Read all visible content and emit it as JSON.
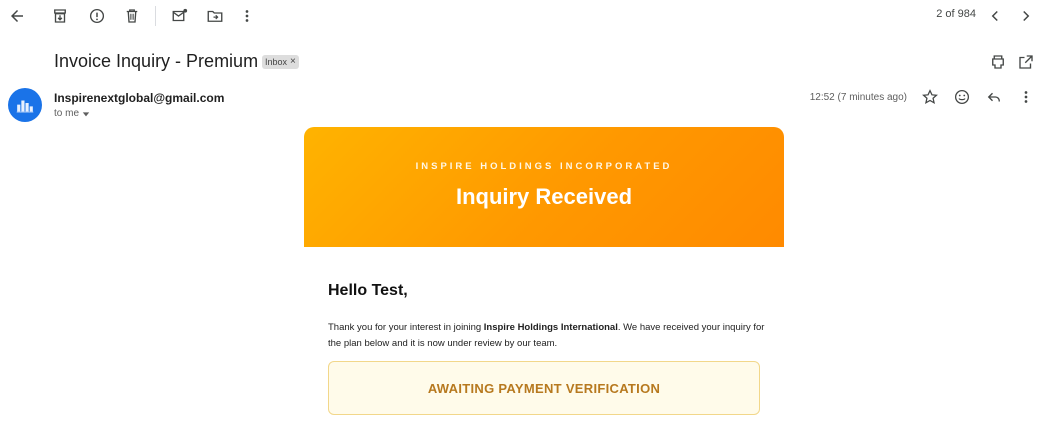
{
  "toolbar": {
    "icons": [
      "back-arrow-icon",
      "archive-icon",
      "report-spam-icon",
      "delete-icon",
      "mark-unread-icon",
      "move-to-icon",
      "more-vert-icon"
    ],
    "count": "2 of 984"
  },
  "email": {
    "subject": "Invoice Inquiry - Premium",
    "label_chip": "Inbox",
    "label_chip_close": "×",
    "sender": "Inspirenextglobal@gmail.com",
    "recipient_label": "to me",
    "timestamp": "12:52 (7 minutes ago)"
  },
  "message": {
    "company": "INSPIRE HOLDINGS INCORPORATED",
    "title": "Inquiry Received",
    "greeting": "Hello Test,",
    "body_before": "Thank you for your interest in joining ",
    "body_bold": "Inspire Holdings International",
    "body_after": ". We have received your inquiry for the plan below and it is now under review by our team.",
    "status": "AWAITING PAYMENT VERIFICATION"
  },
  "colors": {
    "header_gradient_start": "#ffb300",
    "header_gradient_end": "#ff8a00",
    "status_text": "#b7791f",
    "status_bg": "#fffbea",
    "avatar_bg": "#1a73e8"
  }
}
